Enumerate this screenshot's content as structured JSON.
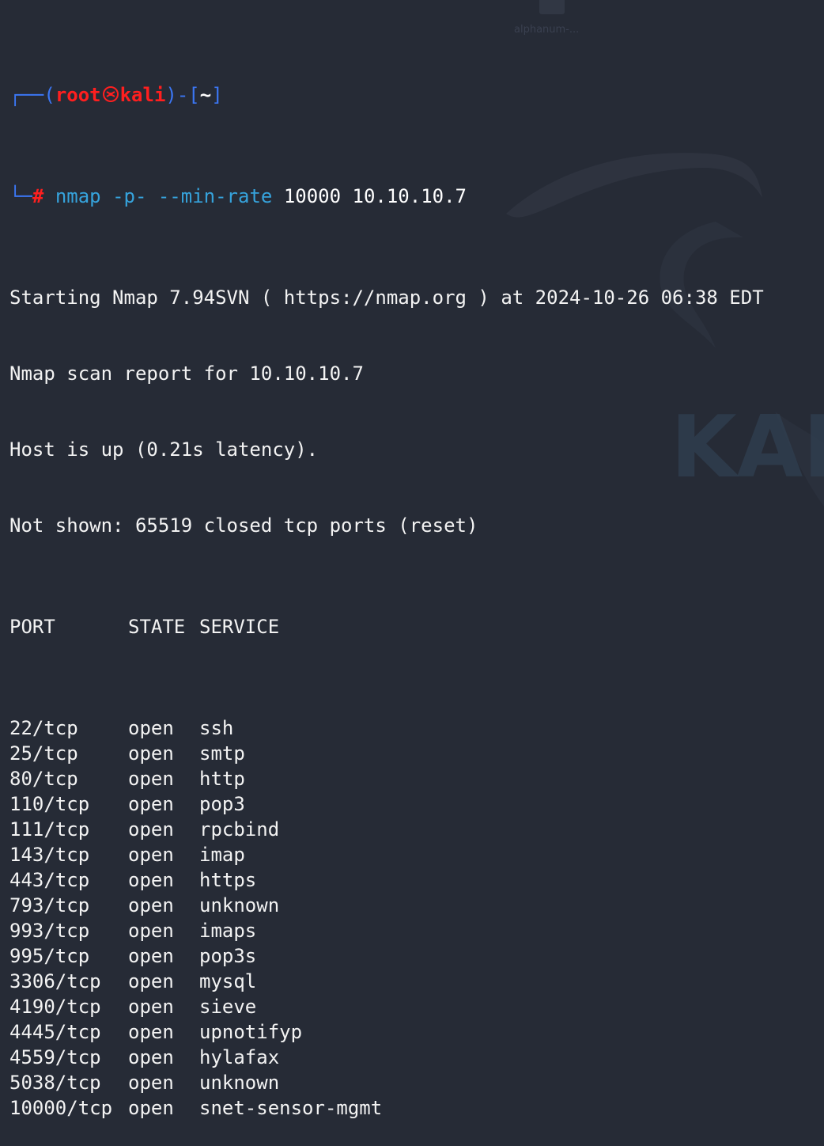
{
  "desktop": {
    "watermark": "KALI",
    "icon_label": "alphanum-..."
  },
  "prompt": {
    "open_paren": "(",
    "user": "root",
    "host": "kali",
    "close_paren": ")",
    "dir_sep": "-[",
    "dir": "~",
    "dir_close": "]",
    "symbol": "#",
    "command": "nmap",
    "flags": "-p- --min-rate",
    "args": "10000 10.10.10.7"
  },
  "output": {
    "start": "Starting Nmap 7.94SVN ( https://nmap.org ) at 2024-10-26 06:38 EDT",
    "report": "Nmap scan report for 10.10.10.7",
    "host": "Host is up (0.21s latency).",
    "not_shown": "Not shown: 65519 closed tcp ports (reset)",
    "headers": {
      "port": "PORT",
      "state": "STATE",
      "service": "SERVICE"
    },
    "ports": [
      {
        "port": "22/tcp",
        "state": "open",
        "service": "ssh"
      },
      {
        "port": "25/tcp",
        "state": "open",
        "service": "smtp"
      },
      {
        "port": "80/tcp",
        "state": "open",
        "service": "http"
      },
      {
        "port": "110/tcp",
        "state": "open",
        "service": "pop3"
      },
      {
        "port": "111/tcp",
        "state": "open",
        "service": "rpcbind"
      },
      {
        "port": "143/tcp",
        "state": "open",
        "service": "imap"
      },
      {
        "port": "443/tcp",
        "state": "open",
        "service": "https"
      },
      {
        "port": "793/tcp",
        "state": "open",
        "service": "unknown"
      },
      {
        "port": "993/tcp",
        "state": "open",
        "service": "imaps"
      },
      {
        "port": "995/tcp",
        "state": "open",
        "service": "pop3s"
      },
      {
        "port": "3306/tcp",
        "state": "open",
        "service": "mysql"
      },
      {
        "port": "4190/tcp",
        "state": "open",
        "service": "sieve"
      },
      {
        "port": "4445/tcp",
        "state": "open",
        "service": "upnotifyp"
      },
      {
        "port": "4559/tcp",
        "state": "open",
        "service": "hylafax"
      },
      {
        "port": "5038/tcp",
        "state": "open",
        "service": "unknown"
      },
      {
        "port": "10000/tcp",
        "state": "open",
        "service": "snet-sensor-mgmt"
      }
    ]
  },
  "colors": {
    "background": "#262b36",
    "prompt_frame": "#3b76f3",
    "user_host": "#ff1f1f",
    "command": "#36a3dc",
    "text": "#f3f3f3"
  }
}
